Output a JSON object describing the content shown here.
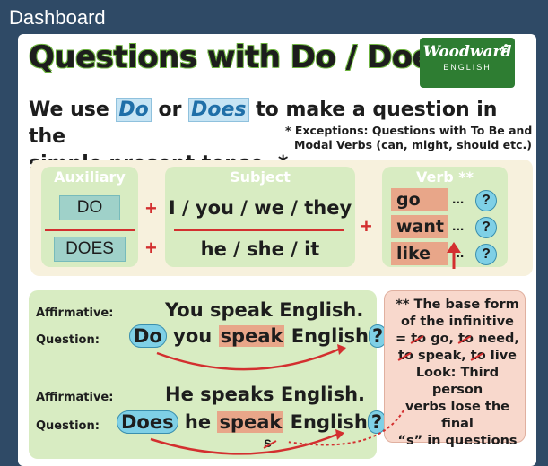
{
  "window": {
    "title": "Dashboard"
  },
  "header": {
    "title": "Questions with Do / Does"
  },
  "logo": {
    "brand": "Woodward",
    "sub": "ENGLISH"
  },
  "intro": {
    "part1": "We use ",
    "do": "Do",
    "or": " or ",
    "does": "Does",
    "part2": " to make a question in the",
    "line2": "simple present tense. *"
  },
  "note": {
    "line1": "* Exceptions: Questions with To Be and",
    "line2": "Modal Verbs (can, might, should etc.)"
  },
  "structure": {
    "auxiliary": {
      "header": "Auxiliary",
      "items": [
        "DO",
        "DOES"
      ]
    },
    "subject": {
      "header": "Subject",
      "items": [
        "I / you / we / they",
        "he / she / it"
      ]
    },
    "verb": {
      "header": "Verb **",
      "items": [
        "go",
        "want",
        "like"
      ],
      "dots": "...",
      "q": "?"
    },
    "plus": "+"
  },
  "examples": [
    {
      "aff_label": "Affirmative:",
      "aff": "You speak English.",
      "q_label": "Question:",
      "q_aux": "Do",
      "q_subj": " you ",
      "q_verb": "speak",
      "q_rest": " English",
      "q_mark": "?"
    },
    {
      "aff_label": "Affirmative:",
      "aff": "He speaks English.",
      "q_label": "Question:",
      "q_aux": "Does",
      "q_subj": " he ",
      "q_verb": "speak",
      "q_rest": " English",
      "q_mark": "?",
      "removed": "s"
    }
  ],
  "rule": {
    "l1": "** The base form",
    "l2": "of the infinitive",
    "l3a": "= ",
    "l3b": "to",
    "l3c": " go, ",
    "l3d": "to",
    "l3e": " need,",
    "l4a": "",
    "l4b": "to",
    "l4c": " speak, ",
    "l4d": "to",
    "l4e": " live",
    "l5": "Look: Third person",
    "l6": "verbs lose the final",
    "l7": "“s” in questions"
  },
  "colors": {
    "accent_red": "#d32f2f",
    "accent_blue": "#7fd0e6",
    "green": "#d8ecc2"
  }
}
